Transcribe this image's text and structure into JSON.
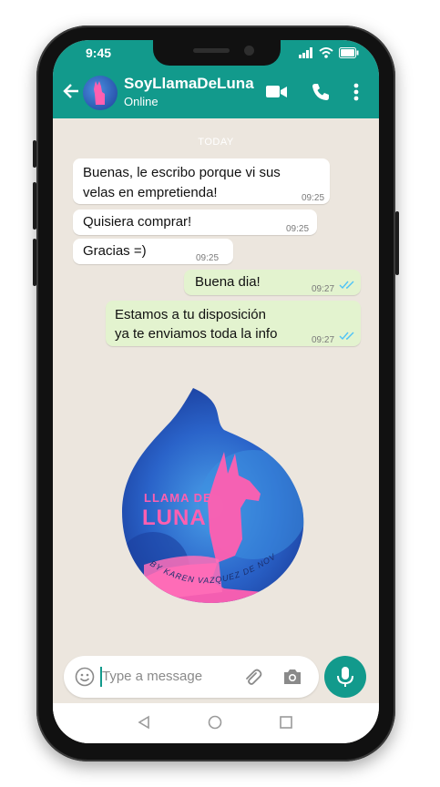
{
  "status_bar": {
    "time": "9:45"
  },
  "header": {
    "contact_name": "SoyLlamaDeLuna",
    "contact_status": "Online",
    "icons": [
      "back-arrow-icon",
      "video-call-icon",
      "phone-icon",
      "more-vert-icon"
    ]
  },
  "chat": {
    "date_label": "TODAY",
    "messages": [
      {
        "direction": "in",
        "line1": "Buenas, le escribo porque vi sus",
        "line2": "velas en empretienda!",
        "time": "09:25"
      },
      {
        "direction": "in",
        "line1": "Quisiera comprar!",
        "time": "09:25"
      },
      {
        "direction": "in",
        "line1": "Gracias =)",
        "time": "09:25"
      },
      {
        "direction": "out",
        "line1": "Buena dia!",
        "time": "09:27",
        "read": true
      },
      {
        "direction": "out",
        "line1": "Estamos a tu  disposición",
        "line2": "ya te enviamos toda  la info",
        "time": "09:27",
        "read": true
      }
    ],
    "sticker": {
      "title_line1": "LLAMA DE",
      "title_line2": "LUNA",
      "byline": "BY KAREN VAZQUEZ DE NOVOA"
    }
  },
  "composer": {
    "placeholder": "Type a message",
    "icons": [
      "emoji-icon",
      "attach-icon",
      "camera-icon",
      "mic-icon"
    ]
  },
  "colors": {
    "brand": "#129a8c",
    "outgoing_bubble": "#e3f3cf",
    "incoming_bubble": "#ffffff",
    "chat_background": "#ece6de",
    "read_ticks": "#4fc3f7",
    "sticker_blue": "#2a63c9",
    "sticker_pink": "#ff5fb0"
  }
}
